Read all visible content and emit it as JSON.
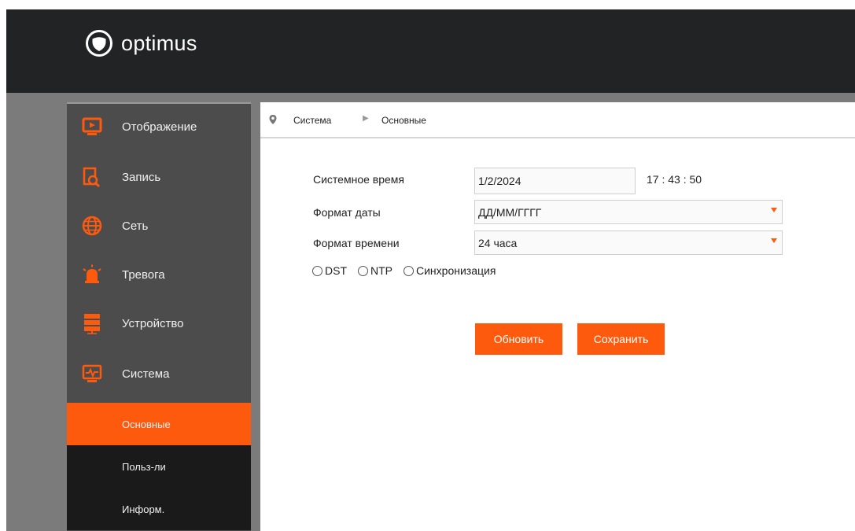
{
  "brand": {
    "name": "optimus"
  },
  "colors": {
    "accent": "#fe5a0e",
    "header_bg": "#222325",
    "sidebar_bg": "#4c4c4c",
    "submenu_bg": "#1a1a1a"
  },
  "sidebar": {
    "items": [
      {
        "label": "Отображение",
        "icon": "display-icon"
      },
      {
        "label": "Запись",
        "icon": "record-icon"
      },
      {
        "label": "Сеть",
        "icon": "globe-icon"
      },
      {
        "label": "Тревога",
        "icon": "alarm-icon"
      },
      {
        "label": "Устройство",
        "icon": "storage-icon"
      },
      {
        "label": "Система",
        "icon": "system-icon"
      }
    ],
    "subitems": [
      {
        "label": "Основные",
        "active": true
      },
      {
        "label": "Польз-ли",
        "active": false
      },
      {
        "label": "Информ.",
        "active": false
      }
    ]
  },
  "breadcrumb": {
    "parent": "Система",
    "current": "Основные",
    "separator": "▶"
  },
  "form": {
    "system_time": {
      "label": "Системное время",
      "date": "1/2/2024",
      "time": "17 : 43 : 50"
    },
    "date_format": {
      "label": "Формат даты",
      "value": "ДД/ММ/ГГГГ"
    },
    "time_format": {
      "label": "Формат времени",
      "value": "24 часа"
    },
    "options": {
      "dst": "DST",
      "ntp": "NTP",
      "sync": "Синхронизация"
    }
  },
  "buttons": {
    "refresh": "Обновить",
    "save": "Сохранить"
  }
}
